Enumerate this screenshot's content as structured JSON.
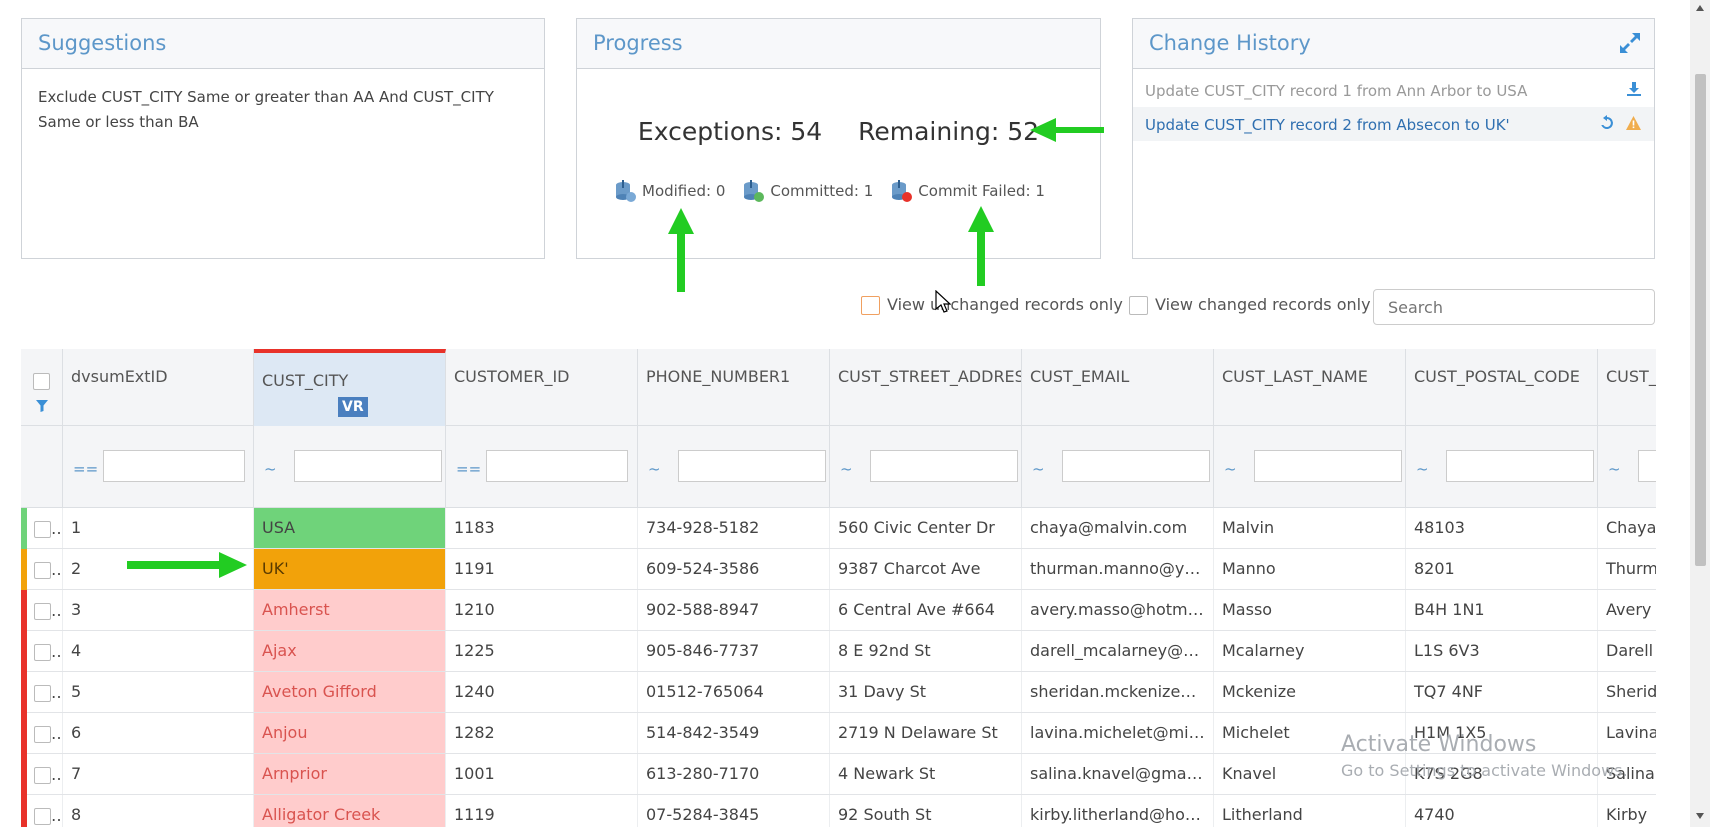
{
  "suggestions": {
    "title": "Suggestions",
    "text": "Exclude CUST_CITY Same or greater than AA And CUST_CITY Same or less than BA"
  },
  "progress": {
    "title": "Progress",
    "exceptions": "Exceptions: 54",
    "remaining": "Remaining: 52",
    "modified": "Modified: 0",
    "committed": "Committed: 1",
    "commit_failed": "Commit Failed: 1"
  },
  "history": {
    "title": "Change History",
    "items": [
      {
        "text": "Update CUST_CITY record 1 from Ann Arbor to USA"
      },
      {
        "text": "Update CUST_CITY record 2 from Absecon to UK'"
      }
    ]
  },
  "filters": {
    "unchanged": "View unchanged records only",
    "changed": "View changed records only",
    "search_placeholder": "Search"
  },
  "table": {
    "badge": "VR",
    "columns": [
      "dvsumExtID",
      "CUST_CITY",
      "CUSTOMER_ID",
      "PHONE_NUMBER1",
      "CUST_STREET_ADDRESS",
      "CUST_EMAIL",
      "CUST_LAST_NAME",
      "CUST_POSTAL_CODE",
      "CUST_F"
    ],
    "filter_ops": [
      "==",
      "~",
      "==",
      "~",
      "~",
      "~",
      "~",
      "~",
      "~"
    ],
    "rows": [
      {
        "status": "ok",
        "cells": [
          "1",
          "USA",
          "1183",
          "734-928-5182",
          "560 Civic Center Dr",
          "chaya@malvin.com",
          "Malvin",
          "48103",
          "Chaya"
        ]
      },
      {
        "status": "warn",
        "cells": [
          "2",
          "UK'",
          "1191",
          "609-524-3586",
          "9387 Charcot Ave",
          "thurman.manno@ya...",
          "Manno",
          "8201",
          "Thurm"
        ]
      },
      {
        "status": "err",
        "cells": [
          "3",
          "Amherst",
          "1210",
          "902-588-8947",
          "6 Central Ave #664",
          "avery.masso@hotmai...",
          "Masso",
          "B4H 1N1",
          "Avery"
        ]
      },
      {
        "status": "err",
        "cells": [
          "4",
          "Ajax",
          "1225",
          "905-846-7737",
          "8 E 92nd St",
          "darell_mcalarney@m...",
          "Mcalarney",
          "L1S 6V3",
          "Darell"
        ]
      },
      {
        "status": "err",
        "cells": [
          "5",
          "Aveton Gifford",
          "1240",
          "01512-765064",
          "31 Davy St",
          "sheridan.mckenize@...",
          "Mckenize",
          "TQ7 4NF",
          "Sherid"
        ]
      },
      {
        "status": "err",
        "cells": [
          "6",
          "Anjou",
          "1282",
          "514-842-3549",
          "2719 N Delaware St",
          "lavina.michelet@mic...",
          "Michelet",
          "H1M 1X5",
          "Lavina"
        ]
      },
      {
        "status": "err",
        "cells": [
          "7",
          "Arnprior",
          "1001",
          "613-280-7170",
          "4 Newark St",
          "salina.knavel@gmail....",
          "Knavel",
          "K7S 2G8",
          "Salina"
        ]
      },
      {
        "status": "err",
        "cells": [
          "8",
          "Alligator Creek",
          "1119",
          "07-5284-3845",
          "92 South St",
          "kirby.litherland@hot...",
          "Litherland",
          "4740",
          "Kirby"
        ]
      }
    ]
  },
  "watermark": {
    "line1": "Activate Windows",
    "line2": "Go to Settings to activate Windows."
  },
  "colors": {
    "ok": "#6fd37a",
    "warn": "#f2a20a",
    "err_cell": "#ffcccc",
    "err_text": "#d9534f",
    "err_bar": "#e8322a",
    "arrow": "#22cc22"
  }
}
